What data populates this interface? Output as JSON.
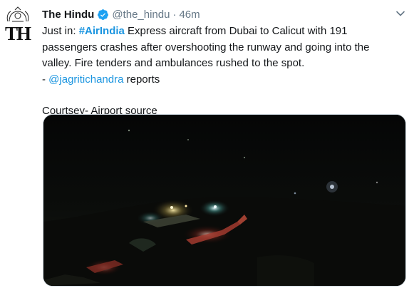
{
  "author": {
    "name": "The Hindu",
    "handle": "@the_hindu",
    "separator": "·",
    "timestamp": "46m",
    "avatar_text": "TH"
  },
  "tweet": {
    "prefix": "Just in: ",
    "hashtag": "#AirIndia",
    "line1_rest": " Express aircraft from Dubai to Calicut with 191 passengers crashes after overshooting the runway and going into the valley. Fire tenders and ambulances rushed to the spot.",
    "mention_prefix": "- ",
    "mention": "@jagritichandra",
    "mention_suffix": " reports",
    "credit": "Courtsey- Airport source"
  },
  "colors": {
    "link": "#1b95e0",
    "verified": "#1da1f2",
    "muted": "#657786"
  },
  "icons": {
    "verified": "verified-badge-icon",
    "menu": "chevron-down-icon"
  }
}
